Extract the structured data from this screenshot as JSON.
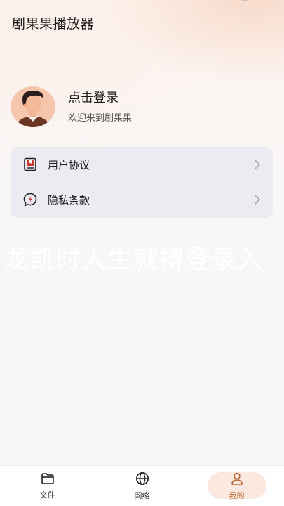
{
  "app": {
    "title": "剧果果播放器"
  },
  "status_fragment": "···",
  "profile": {
    "login_title": "点击登录",
    "login_subtitle": "欢迎来到剧果果"
  },
  "menu": {
    "items": [
      {
        "label": "用户协议",
        "icon": "document-book-icon"
      },
      {
        "label": "隐私条款",
        "icon": "privacy-speech-icon"
      }
    ]
  },
  "watermark": "龙凯时人生就搏登录入",
  "tabs": [
    {
      "label": "文件",
      "icon": "folder-icon",
      "active": false
    },
    {
      "label": "网络",
      "icon": "globe-icon",
      "active": false
    },
    {
      "label": "我的",
      "icon": "person-icon",
      "active": true
    }
  ],
  "colors": {
    "accent": "#b9632f",
    "active_pill": "#fbe9e0",
    "menu_card": "#ecebf2",
    "icon_red": "#c7362f"
  }
}
